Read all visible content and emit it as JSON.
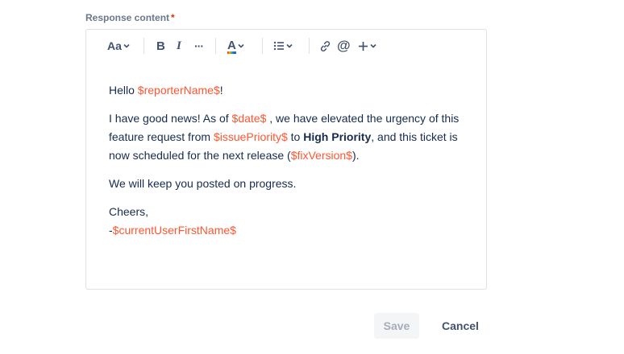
{
  "field": {
    "label": "Response content",
    "required_marker": "*"
  },
  "toolbar": {
    "text_style": "Aa",
    "bold": "B",
    "italic": "I",
    "more_formatting": "···",
    "text_color": "A"
  },
  "content": {
    "greeting_prefix": "Hello ",
    "reporter_var": "$reporterName$",
    "greeting_suffix": "!",
    "p2_a": "I have good news! As of ",
    "date_var": "$date$",
    "p2_b": " , we have elevated the urgency of this feature request from ",
    "priority_var": "$issuePriority$",
    "p2_c": "  to ",
    "high_priority": "High Priority",
    "p2_d": ", and this ticket is now scheduled for the next release (",
    "fix_version_var": "$fixVersion$",
    "p2_e": ").",
    "p3": "We will keep you posted on progress.",
    "signoff": "Cheers,",
    "signature_prefix": "-",
    "user_var": "$currentUserFirstName$"
  },
  "actions": {
    "save_label": "Save",
    "cancel_label": "Cancel"
  },
  "colors": {
    "variable": "#ff5630",
    "label": "#6b778c",
    "required": "#de350b",
    "text": "#172b4d",
    "save_disabled_bg": "#f4f5f7",
    "save_disabled_text": "#a5adba"
  }
}
